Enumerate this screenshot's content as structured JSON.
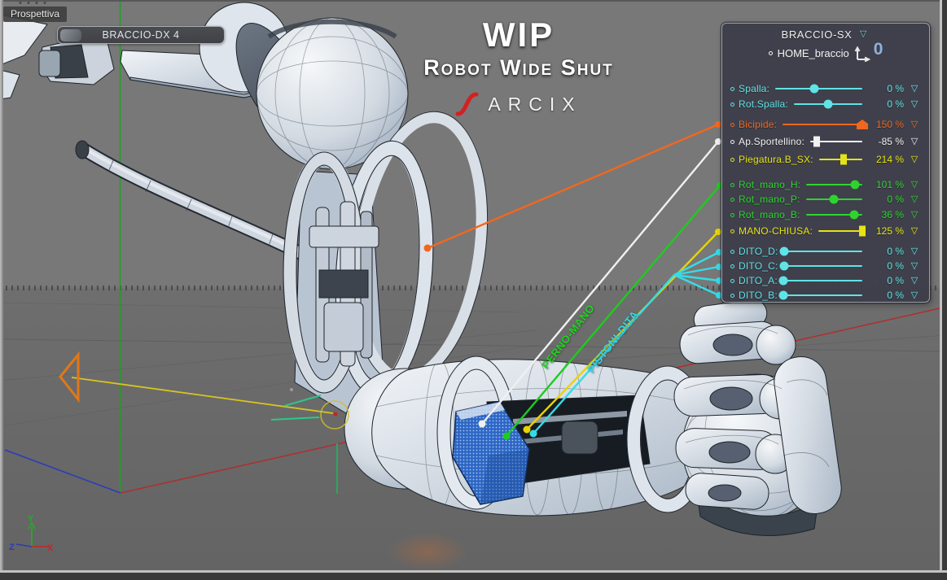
{
  "viewport": {
    "label": "Prospettiva",
    "object_tag": "BRACCIO-DX 4"
  },
  "title": {
    "line1": "WIP",
    "line2": "Robot Wide Shut",
    "brand": "ARCIX"
  },
  "hud": {
    "title": "BRACCIO-SX",
    "home_label": "HOME_braccio",
    "home_value": "0",
    "rows": [
      {
        "id": "spalla",
        "label": "Spalla:",
        "value": "0 %",
        "color": "cyan",
        "knob": "circle",
        "pos": 45,
        "gap": 0
      },
      {
        "id": "rot-spalla",
        "label": "Rot.Spalla:",
        "value": "0 %",
        "color": "cyan",
        "knob": "circle",
        "pos": 50,
        "gap": 1
      },
      {
        "id": "bicipide",
        "label": "Bicipide:",
        "value": "150 %",
        "color": "orange",
        "knob": "pent",
        "pos": 100,
        "gap": 7
      },
      {
        "id": "ap-sportellino",
        "label": "Ap.Sportellino:",
        "value": "-85 %",
        "color": "white",
        "knob": "square",
        "pos": 13,
        "gap": 3
      },
      {
        "id": "piegatura-b-sx",
        "label": "Piegatura.B_SX:",
        "value": "214 %",
        "color": "yellow",
        "knob": "square",
        "pos": 57,
        "gap": 4
      },
      {
        "id": "rot-mano-h",
        "label": "Rot_mano_H:",
        "value": "101 %",
        "color": "green",
        "knob": "circle",
        "pos": 87,
        "gap": 13
      },
      {
        "id": "rot-mano-p",
        "label": "Rot_mano_P:",
        "value": "0 %",
        "color": "green",
        "knob": "circle",
        "pos": 50,
        "gap": 0
      },
      {
        "id": "rot-mano-b",
        "label": "Rot_mano_B:",
        "value": "36 %",
        "color": "green",
        "knob": "circle",
        "pos": 86,
        "gap": 1
      },
      {
        "id": "mano-chiusa",
        "label": "MANO-CHIUSA:",
        "value": "125 %",
        "color": "yellow",
        "knob": "square",
        "pos": 100,
        "gap": 2
      },
      {
        "id": "dito-d",
        "label": "DITO_D:",
        "value": "0 %",
        "color": "cyan",
        "knob": "circle",
        "pos": 0,
        "gap": 7
      },
      {
        "id": "dito-c",
        "label": "DITO_C:",
        "value": "0 %",
        "color": "cyan",
        "knob": "circle",
        "pos": 0,
        "gap": 0
      },
      {
        "id": "dito-a",
        "label": "DITO_A:",
        "value": "0 %",
        "color": "cyan",
        "knob": "circle",
        "pos": 0,
        "gap": 0
      },
      {
        "id": "dito-b",
        "label": "DITO_B:",
        "value": "0 %",
        "color": "cyan",
        "knob": "circle",
        "pos": 0,
        "gap": 0
      }
    ],
    "dropdown_glyph": "▽"
  },
  "annotations": {
    "perno": "PERNO-MANO",
    "pistoni": "PISTONI-DITA"
  },
  "axis_gizmo": {
    "x": "X",
    "y": "Y",
    "z": "Z"
  },
  "colors": {
    "cyan": "#5fe3e6",
    "green": "#2ed42e",
    "orange": "#f2671e",
    "yellow": "#e6e316",
    "white": "#f2f2f2",
    "panel_bg": "#3d3e49",
    "viewport_bg": "#787878",
    "axis_x": "#c02828",
    "axis_y": "#20b020",
    "axis_z": "#2b3bbb",
    "brand_red": "#d42020",
    "selection_blue": "#2d66c4"
  }
}
